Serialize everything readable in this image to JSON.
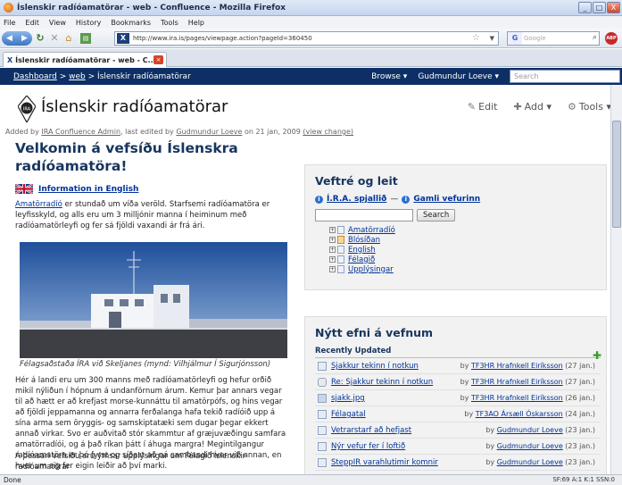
{
  "window": {
    "title": "Íslenskir radíóamatörar - web - Confluence - Mozilla Firefox",
    "controls": [
      "_",
      "□",
      "X"
    ]
  },
  "menu": [
    "File",
    "Edit",
    "View",
    "History",
    "Bookmarks",
    "Tools",
    "Help"
  ],
  "nav": {
    "url": "http://www.ira.is/pages/viewpage.action?pageId=360450",
    "search_placeholder": "Google",
    "addon": "ABP"
  },
  "tab": {
    "label": "Íslenskir radíóamatörar - web - C...",
    "icon": "ira-favicon"
  },
  "confluence_bar": {
    "breadcrumb": [
      "Dashboard",
      "web",
      "Íslenskir radíóamatörar"
    ],
    "sep": ">",
    "browse": "Browse ▾",
    "user": "Gudmundur Loeve ▾",
    "search_placeholder": "Search"
  },
  "page": {
    "title": "Íslenskir radíóamatörar",
    "actions": {
      "edit": "Edit",
      "add": "Add ▾",
      "tools": "Tools ▾"
    },
    "meta": {
      "prefix": "Added by ",
      "creator": "IRA Confluence Admin",
      "mid": ", last edited by ",
      "editor": "Gudmundur Loeve",
      "date": " on 21 jan, 2009 ",
      "view_change": "(view change)"
    },
    "heading": "Velkomin á vefsíðu Íslenskra radíóamatöra!",
    "english_link": "Information in English",
    "intro_link": "Amatörradíó",
    "intro_text": " er stundað um víða veröld. Starfsemi radíóamatöra er leyfisskyld, og alls eru um 3 milljónir manna í heiminum með radíóamatörleyfi og fer sá fjöldi vaxandi ár frá ári.",
    "caption": "Félagsaðstaða ÍRA við Skeljanes (mynd: Vilhjálmur Í Sigurjónsson)",
    "para2": "Hér á landi eru um 300 manns með radíóamatörleyfi og hefur orðið mikil nýliðun í hópnum á undanförnum árum. Kemur þar annars vegar til að hætt er að krefjast morse-kunnáttu til amatörpófs, og hins vegar að fjöldi jeppamanna og annarra ferðalanga hafa tekið radíóið upp á sína arma sem öryggis- og samskiptatæki sem dugar þegar ekkert annað virkar. Svo er auðvitað stór skammtur af græjuvæðingu samfara amatörradíói, og á það ríkan þátt í áhuga margra! Megintilgangur radíóamatöra er þó fyrst og síðast að ná sambandi hver við annan, en hver um sig fer eigin leiðir að því marki.",
    "para3": "Á þessari vefsíðu eru ýmsar upplýsingar um Félagið Íslenskir radíóamatörar"
  },
  "panel1": {
    "title": "Veftré og leit",
    "link1": "Í.R.A. spjallið",
    "dash": "—",
    "link2": "Gamli vefurinn",
    "search_button": "Search",
    "tree": [
      "Amatörradíó",
      "Blósíðan",
      "English",
      "Félagið",
      "Upplýsingar"
    ]
  },
  "panel2": {
    "title": "Nýtt efni á vefnum",
    "subtitle": "Recently Updated",
    "items": [
      {
        "title": "Sjakkur tekinn í notkun",
        "by": "by ",
        "author": "TF3HR Hrafnkell Eiríksson",
        "date": " (27 jan.)",
        "type": "page"
      },
      {
        "title": "Re: Sjakkur tekinn í notkun",
        "by": "by ",
        "author": "TF3HR Hrafnkell Eiríksson",
        "date": " (27 jan.)",
        "type": "comment"
      },
      {
        "title": "sjakk.jpg",
        "by": "by ",
        "author": "TF3HR Hrafnkell Eiríksson",
        "date": " (26 jan.)",
        "type": "image"
      },
      {
        "title": "Félagatal",
        "by": "by ",
        "author": "TF3AO Ársæll Óskarsson",
        "date": " (24 jan.)",
        "type": "page"
      },
      {
        "title": "Vetrarstarf að hefjast",
        "by": "by ",
        "author": "Gudmundur Loeve",
        "date": " (23 jan.)",
        "type": "page"
      },
      {
        "title": "Nýr vefur fer í loftið",
        "by": "by ",
        "author": "Gudmundur Loeve",
        "date": " (23 jan.)",
        "type": "page"
      },
      {
        "title": "SteppIR varahlutimir komnir",
        "by": "by ",
        "author": "Gudmundur Loeve",
        "date": " (23 jan.)",
        "type": "page"
      }
    ]
  },
  "status": {
    "left": "Done",
    "right": "SF:69 A:1 K:1 SSN:0"
  }
}
